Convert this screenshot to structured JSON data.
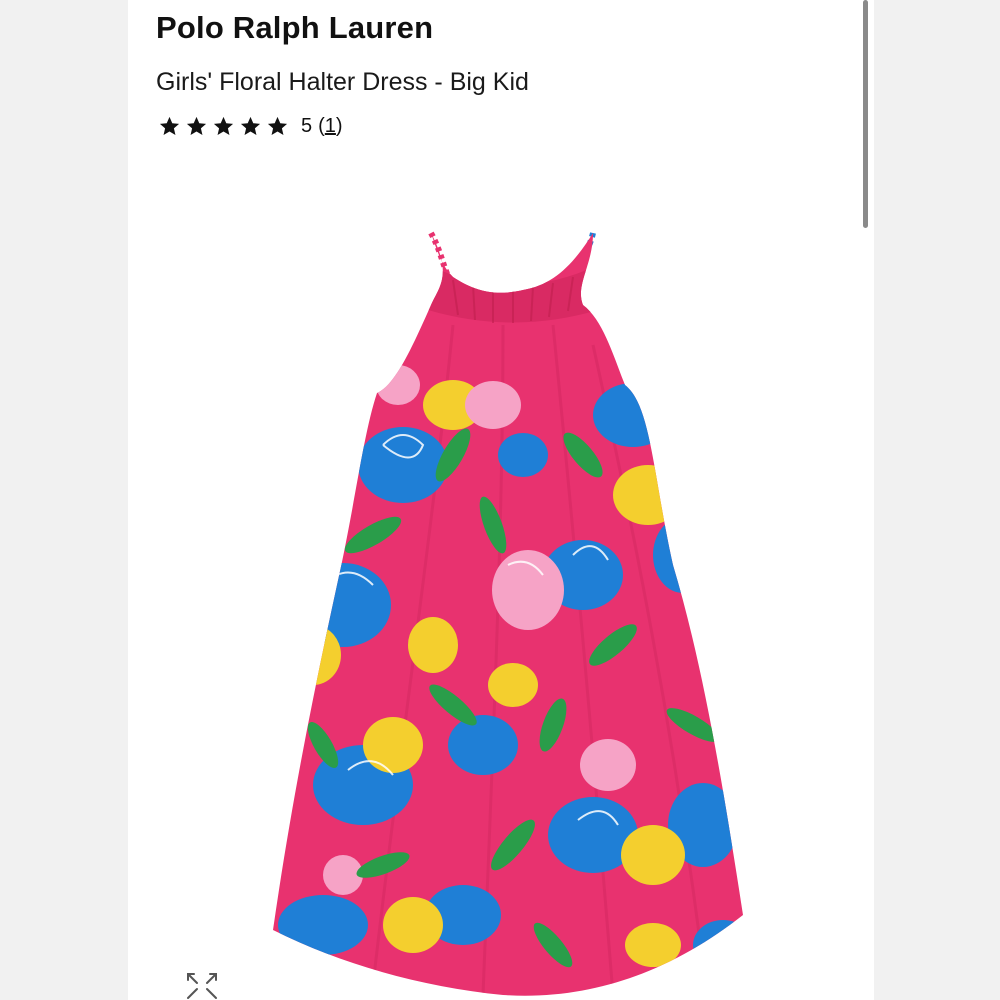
{
  "product": {
    "brand": "Polo Ralph Lauren",
    "title": "Girls' Floral Halter Dress - Big Kid",
    "rating": {
      "value": "5",
      "count_open": "(",
      "count": "1",
      "count_close": ")",
      "stars_filled": 5,
      "stars_total": 5
    }
  },
  "image": {
    "description_icon": "product-image",
    "expand_icon": "expand-arrows-icon"
  },
  "colors": {
    "dress_pink": "#e8326f",
    "flower_blue": "#1f7fd6",
    "flower_yellow": "#f4cf2e",
    "leaf_green": "#2a9d4a",
    "flower_light_pink": "#f6a3c6"
  }
}
